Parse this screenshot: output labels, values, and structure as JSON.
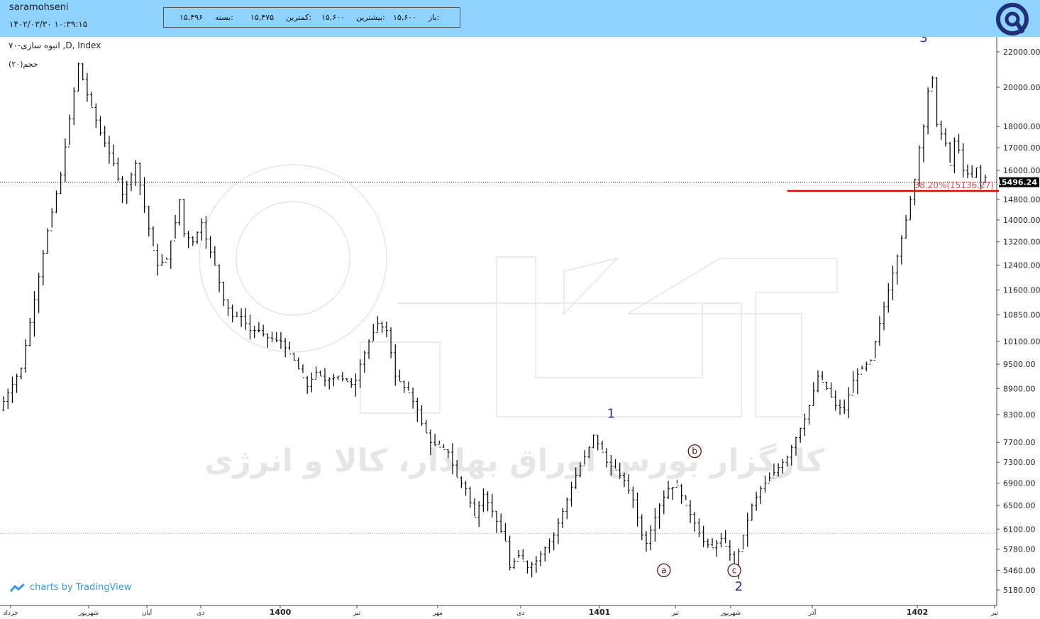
{
  "header": {
    "user": "saramohseni",
    "datetime": "۱۴۰۲/۰۳/۳۰ ۱۰:۳۹:۱۵",
    "open_label": "باز:",
    "open_value": "۱۵,۶۰۰",
    "high_label": "بیشترین:",
    "high_value": "۱۵,۶۰۰",
    "low_label": "کمترین:",
    "low_value": "۱۵,۴۷۵",
    "close_label": "بسته:",
    "close_value": "۱۵,۴۹۶"
  },
  "symbol": "انبوه سازی-۷۰ ,D, Index",
  "volume_label": "حجم(۲۰)",
  "tradingview": "charts by TradingView",
  "watermark": "کارگزار بورس اوراق بهادار، کالا و انرژی",
  "colors": {
    "header_bg": "#8fd3ff",
    "fib_line": "#e00000",
    "fib_text": "#e05050",
    "wave": "#2f2f9f",
    "circle_label": "#5a1010"
  },
  "chart_data": {
    "type": "bar",
    "y_scale": "log",
    "ylim": [
      5000,
      23500
    ],
    "y_ticks": [
      "22000.00",
      "20000.00",
      "18000.00",
      "17000.00",
      "16000.00",
      "14800.00",
      "14000.00",
      "13200.00",
      "12400.00",
      "11600.00",
      "10850.00",
      "10100.00",
      "9500.00",
      "8900.00",
      "8300.00",
      "7700.00",
      "7300.00",
      "6900.00",
      "6500.00",
      "6100.00",
      "5780.00",
      "5460.00",
      "5180.00"
    ],
    "x_ticks": [
      "خرداد",
      "شهریور",
      "آبان",
      "دی",
      "1400",
      "تیر",
      "مهر",
      "دی",
      "1401",
      "تیر",
      "شهریور",
      "آذر",
      "1402",
      "تیر"
    ],
    "last_price": 15496.24,
    "last_price_label": "15496.24",
    "fib_level": {
      "label": "38.20%(15136.27)",
      "value": 15136.27
    },
    "dotted_support": 6025,
    "price_path": [
      [
        0,
        8400
      ],
      [
        2,
        8800
      ],
      [
        5,
        9400
      ],
      [
        8,
        11300
      ],
      [
        11,
        13600
      ],
      [
        14,
        15800
      ],
      [
        17,
        19800
      ],
      [
        18,
        21300
      ],
      [
        20,
        19600
      ],
      [
        23,
        17700
      ],
      [
        26,
        16300
      ],
      [
        28,
        15000
      ],
      [
        30,
        15800
      ],
      [
        31,
        16300
      ],
      [
        33,
        14500
      ],
      [
        35,
        12900
      ],
      [
        36,
        12400
      ],
      [
        38,
        12600
      ],
      [
        40,
        13900
      ],
      [
        41,
        14800
      ],
      [
        42,
        13500
      ],
      [
        44,
        13200
      ],
      [
        46,
        13900
      ],
      [
        47,
        13300
      ],
      [
        49,
        12400
      ],
      [
        51,
        11300
      ],
      [
        53,
        10800
      ],
      [
        55,
        10800
      ],
      [
        57,
        10400
      ],
      [
        59,
        10400
      ],
      [
        61,
        10200
      ],
      [
        64,
        10100
      ],
      [
        67,
        9600
      ],
      [
        70,
        8950
      ],
      [
        72,
        9300
      ],
      [
        74,
        9100
      ],
      [
        77,
        9200
      ],
      [
        80,
        9000
      ],
      [
        81,
        9100
      ],
      [
        82,
        9500
      ],
      [
        84,
        10100
      ],
      [
        86,
        10600
      ],
      [
        88,
        10400
      ],
      [
        89,
        9800
      ],
      [
        90,
        9200
      ],
      [
        93,
        8800
      ],
      [
        95,
        8400
      ],
      [
        96,
        8100
      ],
      [
        98,
        7700
      ],
      [
        100,
        7600
      ],
      [
        102,
        7500
      ],
      [
        104,
        7000
      ],
      [
        106,
        6800
      ],
      [
        108,
        6300
      ],
      [
        110,
        6700
      ],
      [
        112,
        6400
      ],
      [
        115,
        5900
      ],
      [
        116,
        5500
      ],
      [
        118,
        5680
      ],
      [
        120,
        5500
      ],
      [
        122,
        5600
      ],
      [
        124,
        5800
      ],
      [
        126,
        6000
      ],
      [
        127,
        6200
      ],
      [
        129,
        6600
      ],
      [
        131,
        7050
      ],
      [
        134,
        7600
      ],
      [
        135,
        7850
      ],
      [
        137,
        7500
      ],
      [
        138,
        7300
      ],
      [
        140,
        7150
      ],
      [
        142,
        6950
      ],
      [
        144,
        6600
      ],
      [
        146,
        6000
      ],
      [
        147,
        5870
      ],
      [
        149,
        6300
      ],
      [
        150,
        6500
      ],
      [
        152,
        6800
      ],
      [
        154,
        6850
      ],
      [
        156,
        6500
      ],
      [
        158,
        6200
      ],
      [
        160,
        5900
      ],
      [
        162,
        5800
      ],
      [
        164,
        5950
      ],
      [
        166,
        5700
      ],
      [
        167,
        5500
      ],
      [
        169,
        6000
      ],
      [
        171,
        6500
      ],
      [
        173,
        6800
      ],
      [
        175,
        7000
      ],
      [
        177,
        7200
      ],
      [
        179,
        7400
      ],
      [
        181,
        7800
      ],
      [
        183,
        8200
      ],
      [
        184,
        8500
      ],
      [
        186,
        9200
      ],
      [
        188,
        8900
      ],
      [
        190,
        8500
      ],
      [
        192,
        8400
      ],
      [
        194,
        9100
      ],
      [
        196,
        9400
      ],
      [
        198,
        9600
      ],
      [
        200,
        10600
      ],
      [
        202,
        11600
      ],
      [
        204,
        12700
      ],
      [
        206,
        14000
      ],
      [
        207,
        14800
      ],
      [
        208,
        15600
      ],
      [
        209,
        17000
      ],
      [
        210,
        18000
      ],
      [
        211,
        19800
      ],
      [
        212,
        20500
      ],
      [
        213,
        18100
      ],
      [
        215,
        17200
      ],
      [
        216,
        16200
      ],
      [
        217,
        17300
      ],
      [
        218,
        16900
      ],
      [
        219,
        16000
      ],
      [
        221,
        15700
      ],
      [
        222,
        16100
      ],
      [
        223,
        15500
      ],
      [
        224,
        15700
      ]
    ],
    "waves": [
      {
        "label": "1",
        "i": 138,
        "price": 8230
      },
      {
        "label": "2",
        "i": 167,
        "price": 5170
      },
      {
        "label": "3",
        "i": 209,
        "price": 22600
      }
    ],
    "circles": [
      {
        "label": "a",
        "i": 150,
        "price": 5460
      },
      {
        "label": "b",
        "i": 157,
        "price": 7520
      },
      {
        "label": "c",
        "i": 166,
        "price": 5460
      }
    ]
  }
}
